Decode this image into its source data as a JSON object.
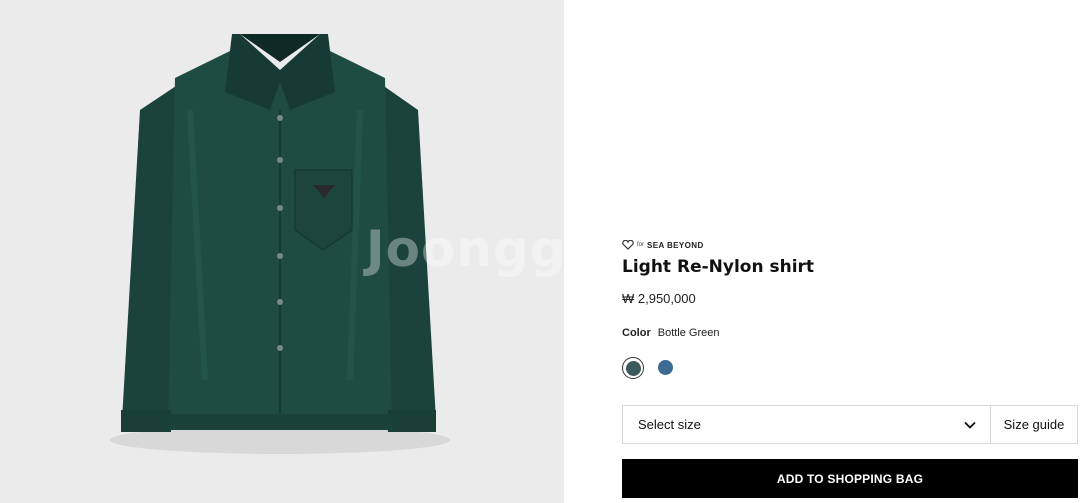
{
  "product": {
    "image_alt": "Light Re-Nylon shirt",
    "watermark": "Joongg",
    "brand_for": "for",
    "brand_tag": "SEA BEYOND",
    "title": "Light Re-Nylon shirt",
    "price": "₩ 2,950,000"
  },
  "color": {
    "label": "Color",
    "value": "Bottle Green",
    "swatches": [
      {
        "name": "Bottle Green",
        "hex": "#3c5a5d",
        "selected": true
      },
      {
        "name": "Blue",
        "hex": "#3d6a93",
        "selected": false
      }
    ]
  },
  "size": {
    "select_label": "Select size",
    "guide_label": "Size guide"
  },
  "actions": {
    "add_to_bag": "ADD TO SHOPPING BAG"
  },
  "colors": {
    "shirt": "#1e4a41",
    "button_bg": "#000000",
    "panel_bg": "#ebebeb"
  }
}
